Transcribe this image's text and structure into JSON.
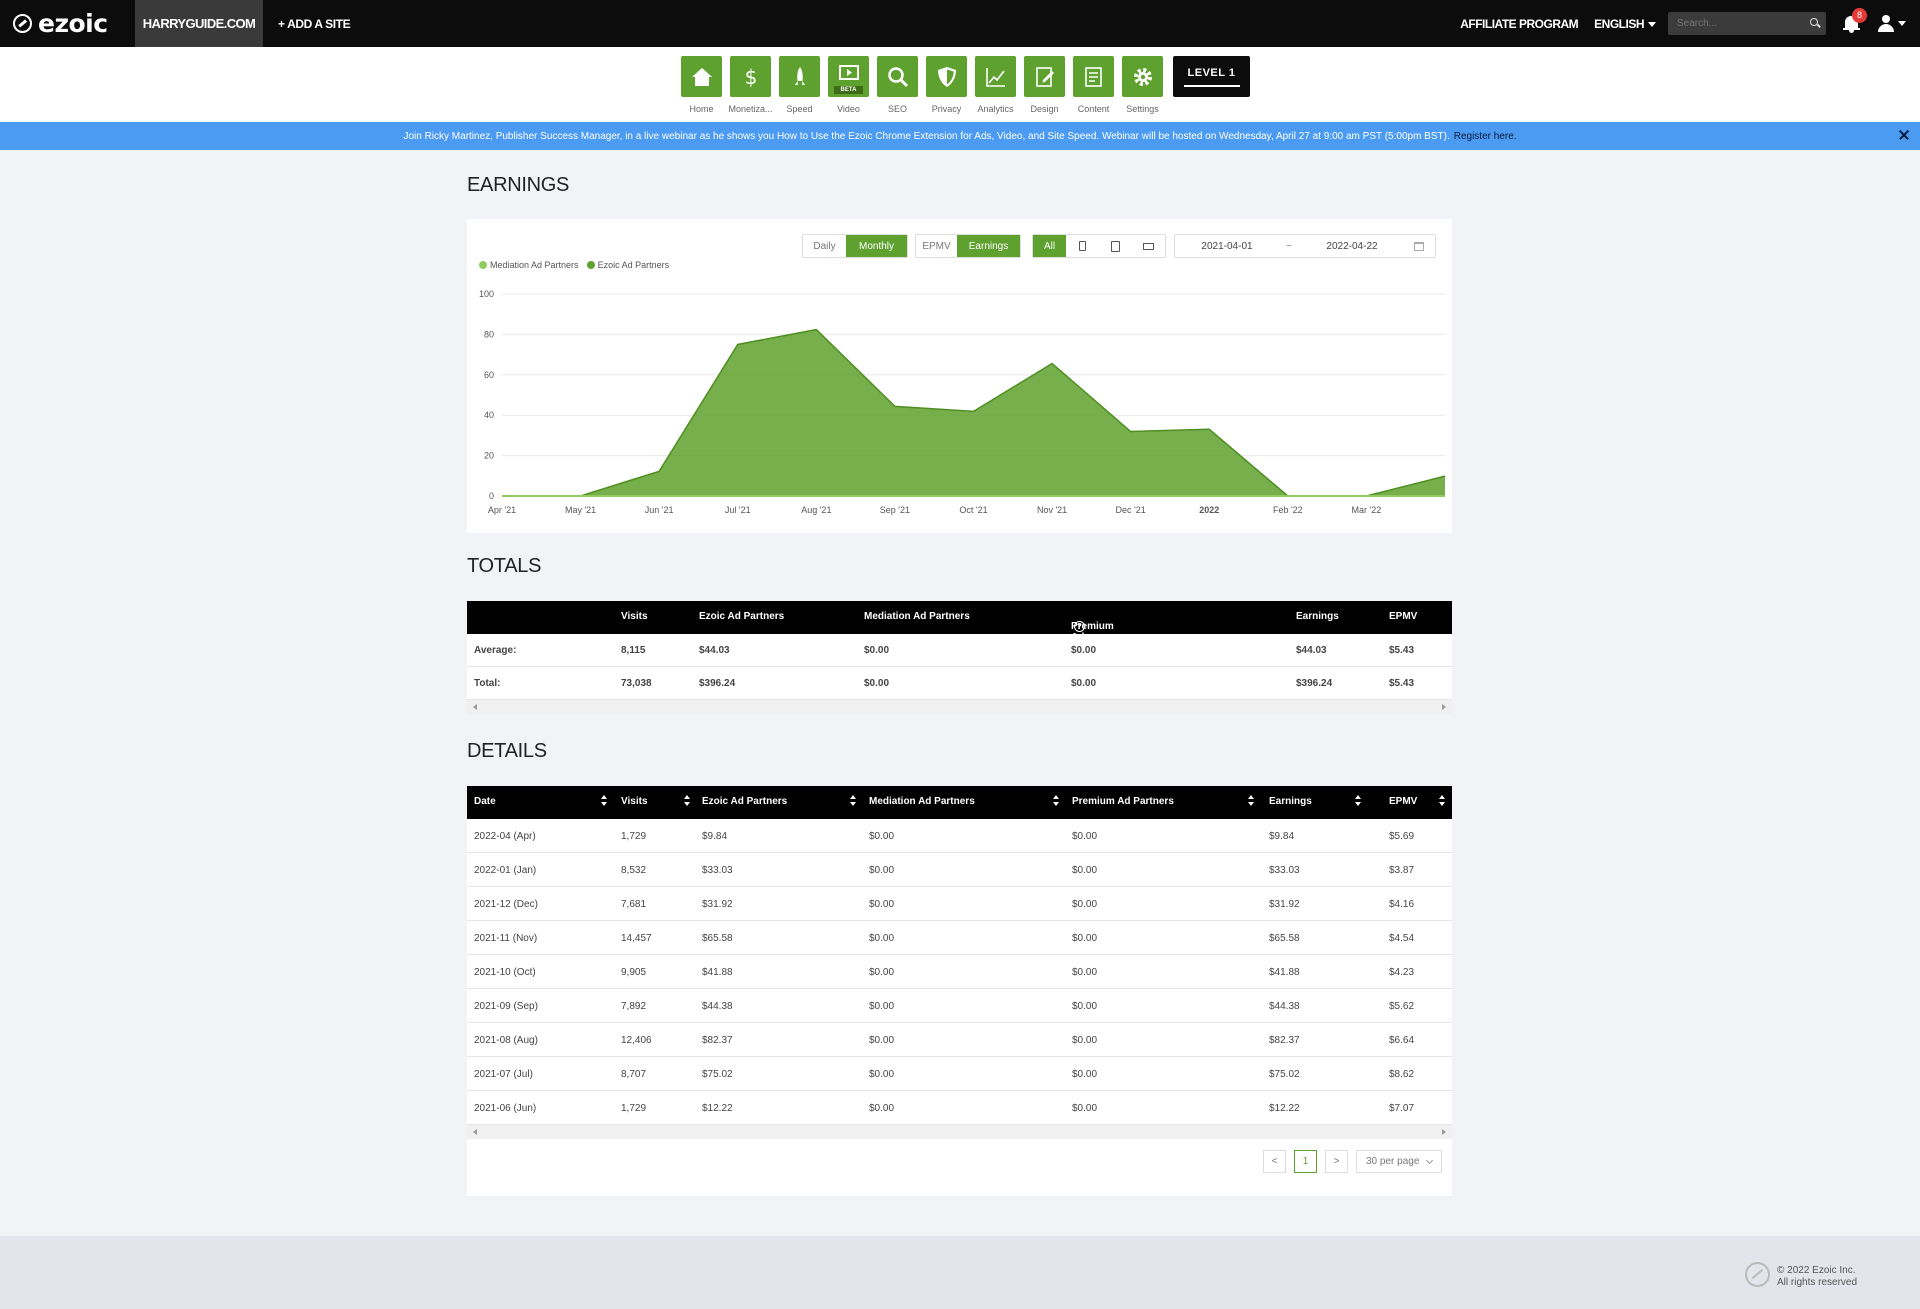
{
  "app": {
    "logo": "ezoic",
    "site": "HARRYGUIDE.COM",
    "add_site": "+ ADD A SITE"
  },
  "topbar": {
    "affiliate": "AFFILIATE PROGRAM",
    "language": "ENGLISH",
    "search_placeholder": "Search...",
    "notif_count": "8"
  },
  "nav": {
    "items": [
      {
        "label": "Home",
        "icon": "home-icon"
      },
      {
        "label": "Monetiza...",
        "icon": "dollar-icon"
      },
      {
        "label": "Speed",
        "icon": "rocket-icon"
      },
      {
        "label": "Video",
        "icon": "video-icon",
        "beta": "BETA"
      },
      {
        "label": "SEO",
        "icon": "search-icon"
      },
      {
        "label": "Privacy",
        "icon": "shield-icon"
      },
      {
        "label": "Analytics",
        "icon": "analytics-icon"
      },
      {
        "label": "Design",
        "icon": "design-icon"
      },
      {
        "label": "Content",
        "icon": "content-icon"
      },
      {
        "label": "Settings",
        "icon": "gear-icon"
      }
    ],
    "level": "LEVEL 1"
  },
  "banner": {
    "text": "Join Ricky Martinez, Publisher Success Manager, in a live webinar as he shows you How to Use the Ezoic Chrome Extension for Ads, Video, and Site Speed. Webinar will be hosted on Wednesday, April 27 at 9:00 am PST (5:00pm BST).",
    "link": "Register here."
  },
  "earnings": {
    "title": "EARNINGS",
    "period": {
      "daily": "Daily",
      "monthly": "Monthly"
    },
    "metric": {
      "epmv": "EPMV",
      "earnings": "Earnings"
    },
    "device_all": "All",
    "date_from": "2021-04-01",
    "date_sep": "~",
    "date_to": "2022-04-22"
  },
  "colors": {
    "accent": "#5fa12e",
    "mediation": "#8fcb5f",
    "ezoic": "#5fa12e"
  },
  "chart_data": {
    "type": "area",
    "series": [
      {
        "name": "Mediation Ad Partners",
        "values": [
          0,
          0,
          0,
          0,
          0,
          0,
          0,
          0,
          0,
          0,
          0,
          0,
          0
        ]
      },
      {
        "name": "Ezoic Ad Partners",
        "values": [
          0,
          0,
          12.22,
          75.02,
          82.37,
          44.38,
          41.88,
          65.58,
          31.92,
          33.03,
          0,
          0,
          9.84
        ]
      }
    ],
    "x_ticks": [
      "Apr '21",
      "May '21",
      "Jun '21",
      "Jul '21",
      "Aug '21",
      "Sep '21",
      "Oct '21",
      "Nov '21",
      "Dec '21",
      "2022",
      "Feb '22",
      "Mar '22",
      ""
    ],
    "y_ticks": [
      "0",
      "20",
      "40",
      "60",
      "80",
      "100"
    ],
    "ylim": [
      0,
      100
    ],
    "grid": true,
    "legend": "top-left"
  },
  "totals": {
    "title": "TOTALS",
    "headers": [
      "",
      "Visits",
      "Ezoic Ad Partners",
      "Mediation Ad Partners",
      "Premium Ad Partners",
      "Earnings",
      "EPMV"
    ],
    "rows": [
      [
        "Average:",
        "8,115",
        "$44.03",
        "$0.00",
        "$0.00",
        "$44.03",
        "$5.43"
      ],
      [
        "Total:",
        "73,038",
        "$396.24",
        "$0.00",
        "$0.00",
        "$396.24",
        "$5.43"
      ]
    ]
  },
  "details": {
    "title": "DETAILS",
    "headers": [
      "Date",
      "Visits",
      "Ezoic Ad Partners",
      "Mediation Ad Partners",
      "Premium Ad Partners",
      "Earnings",
      "EPMV"
    ],
    "rows": [
      [
        "2022-04 (Apr)",
        "1,729",
        "$9.84",
        "$0.00",
        "$0.00",
        "$9.84",
        "$5.69"
      ],
      [
        "2022-01 (Jan)",
        "8,532",
        "$33.03",
        "$0.00",
        "$0.00",
        "$33.03",
        "$3.87"
      ],
      [
        "2021-12 (Dec)",
        "7,681",
        "$31.92",
        "$0.00",
        "$0.00",
        "$31.92",
        "$4.16"
      ],
      [
        "2021-11 (Nov)",
        "14,457",
        "$65.58",
        "$0.00",
        "$0.00",
        "$65.58",
        "$4.54"
      ],
      [
        "2021-10 (Oct)",
        "9,905",
        "$41.88",
        "$0.00",
        "$0.00",
        "$41.88",
        "$4.23"
      ],
      [
        "2021-09 (Sep)",
        "7,892",
        "$44.38",
        "$0.00",
        "$0.00",
        "$44.38",
        "$5.62"
      ],
      [
        "2021-08 (Aug)",
        "12,406",
        "$82.37",
        "$0.00",
        "$0.00",
        "$82.37",
        "$6.64"
      ],
      [
        "2021-07 (Jul)",
        "8,707",
        "$75.02",
        "$0.00",
        "$0.00",
        "$75.02",
        "$8.62"
      ],
      [
        "2021-06 (Jun)",
        "1,729",
        "$12.22",
        "$0.00",
        "$0.00",
        "$12.22",
        "$7.07"
      ]
    ],
    "page": "1",
    "prev": "<",
    "next": ">",
    "per_page": "30 per page"
  },
  "footer": {
    "copyright": "© 2022 Ezoic Inc.",
    "rights": "All rights reserved"
  }
}
